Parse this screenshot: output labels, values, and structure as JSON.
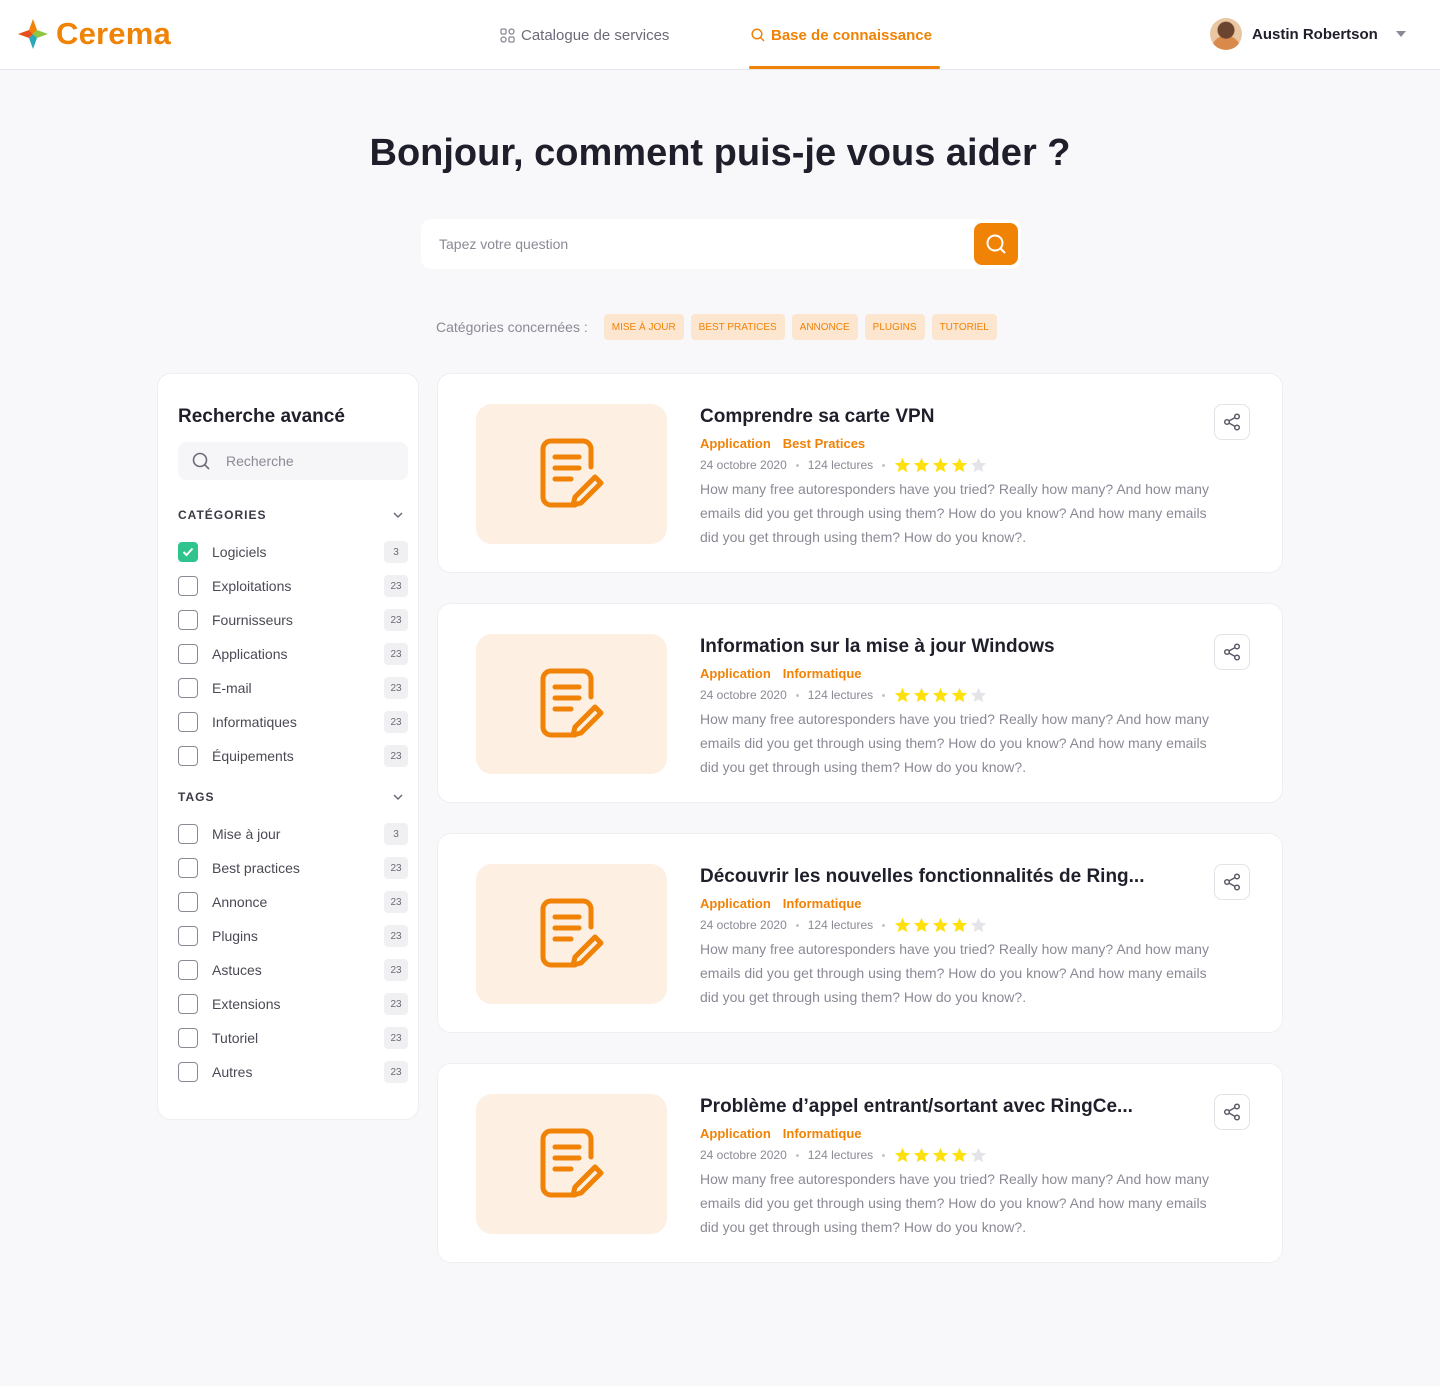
{
  "brand": {
    "name": "Cerema",
    "accent": "#f08206"
  },
  "nav": {
    "items": [
      {
        "label": "Catalogue de services",
        "icon": "grid-icon"
      },
      {
        "label": "Base de connaissance",
        "icon": "search-icon"
      }
    ]
  },
  "user": {
    "name": "Austin Robertson"
  },
  "hero": {
    "title": "Bonjour, comment puis-je vous aider ?",
    "search_placeholder": "Tapez votre question"
  },
  "categories": {
    "label": "Catégories concernées :",
    "chips": [
      "MISE À JOUR",
      "BEST PRATICES",
      "ANNONCE",
      "PLUGINS",
      "TUTORIEL"
    ]
  },
  "sidebar": {
    "title": "Recherche avancé",
    "search_placeholder": "Recherche",
    "categories": {
      "heading": "CATÉGORIES",
      "items": [
        {
          "label": "Logiciels",
          "count": "3",
          "checked": true
        },
        {
          "label": "Exploitations",
          "count": "23",
          "checked": false
        },
        {
          "label": "Fournisseurs",
          "count": "23",
          "checked": false
        },
        {
          "label": "Applications",
          "count": "23",
          "checked": false
        },
        {
          "label": "E-mail",
          "count": "23",
          "checked": false
        },
        {
          "label": "Informatiques",
          "count": "23",
          "checked": false
        },
        {
          "label": "Équipements",
          "count": "23",
          "checked": false
        }
      ]
    },
    "tags": {
      "heading": "TAGS",
      "items": [
        {
          "label": "Mise à jour",
          "count": "3",
          "checked": false
        },
        {
          "label": "Best practices",
          "count": "23",
          "checked": false
        },
        {
          "label": "Annonce",
          "count": "23",
          "checked": false
        },
        {
          "label": "Plugins",
          "count": "23",
          "checked": false
        },
        {
          "label": "Astuces",
          "count": "23",
          "checked": false
        },
        {
          "label": "Extensions",
          "count": "23",
          "checked": false
        },
        {
          "label": "Tutoriel",
          "count": "23",
          "checked": false
        },
        {
          "label": "Autres",
          "count": "23",
          "checked": false
        }
      ]
    }
  },
  "articles": [
    {
      "title": "Comprendre sa carte VPN",
      "tags": [
        "Application",
        "Best Pratices"
      ],
      "date": "24 octobre 2020",
      "reads": "124 lectures",
      "rating": 4,
      "description": "How many free autoresponders have you tried? Really how many? And how many emails did you get through using them? How do you know? And how many emails did you get through using them? How do you know?."
    },
    {
      "title": "Information sur la mise à jour Windows",
      "tags": [
        "Application",
        "Informatique"
      ],
      "date": "24 octobre 2020",
      "reads": "124 lectures",
      "rating": 4,
      "description": "How many free autoresponders have you tried? Really how many? And how many emails did you get through using them? How do you know? And how many emails did you get through using them? How do you know?."
    },
    {
      "title": "Découvrir les nouvelles fonctionnalités de Ring...",
      "tags": [
        "Application",
        "Informatique"
      ],
      "date": "24 octobre 2020",
      "reads": "124 lectures",
      "rating": 4,
      "description": "How many free autoresponders have you tried? Really how many? And how many emails did you get through using them? How do you know? And how many emails did you get through using them? How do you know?."
    },
    {
      "title": "Problème d’appel entrant/sortant avec RingCe...",
      "tags": [
        "Application",
        "Informatique"
      ],
      "date": "24 octobre 2020",
      "reads": "124 lectures",
      "rating": 4,
      "description": "How many free autoresponders have you tried? Really how many? And how many emails did you get through using them? How do you know? And how many emails did you get through using them? How do you know?."
    }
  ]
}
